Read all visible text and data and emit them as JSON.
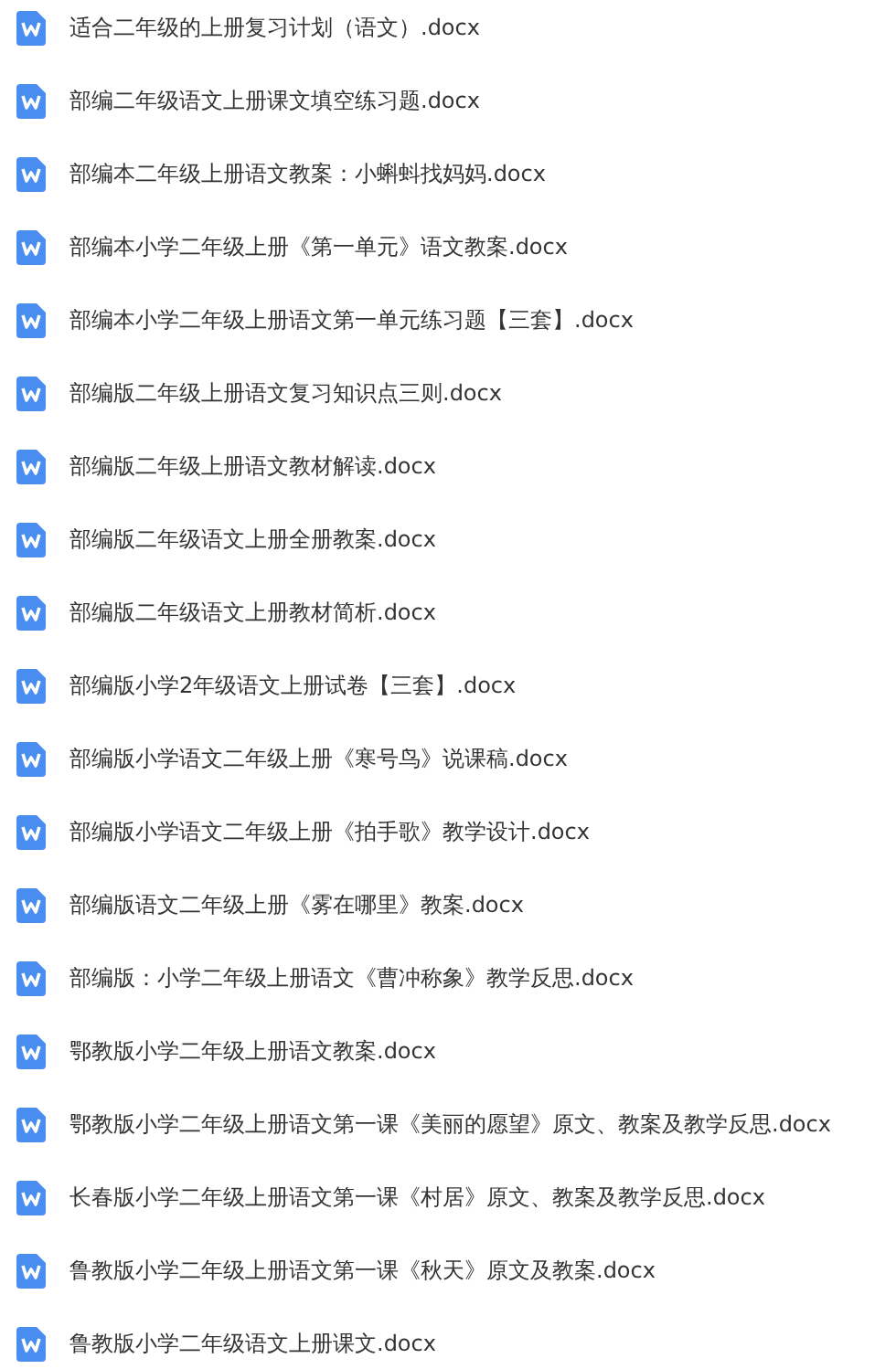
{
  "files": [
    {
      "name": "适合二年级的上册复习计划（语文）.docx"
    },
    {
      "name": "部编二年级语文上册课文填空练习题.docx"
    },
    {
      "name": "部编本二年级上册语文教案：小蝌蚪找妈妈.docx"
    },
    {
      "name": "部编本小学二年级上册《第一单元》语文教案.docx"
    },
    {
      "name": "部编本小学二年级上册语文第一单元练习题【三套】.docx"
    },
    {
      "name": "部编版二年级上册语文复习知识点三则.docx"
    },
    {
      "name": "部编版二年级上册语文教材解读.docx"
    },
    {
      "name": "部编版二年级语文上册全册教案.docx"
    },
    {
      "name": "部编版二年级语文上册教材简析.docx"
    },
    {
      "name": "部编版小学2年级语文上册试卷【三套】.docx"
    },
    {
      "name": "部编版小学语文二年级上册《寒号鸟》说课稿.docx"
    },
    {
      "name": "部编版小学语文二年级上册《拍手歌》教学设计.docx"
    },
    {
      "name": "部编版语文二年级上册《雾在哪里》教案.docx"
    },
    {
      "name": "部编版：小学二年级上册语文《曹冲称象》教学反思.docx"
    },
    {
      "name": "鄂教版小学二年级上册语文教案.docx"
    },
    {
      "name": "鄂教版小学二年级上册语文第一课《美丽的愿望》原文、教案及教学反思.docx"
    },
    {
      "name": "长春版小学二年级上册语文第一课《村居》原文、教案及教学反思.docx"
    },
    {
      "name": "鲁教版小学二年级上册语文第一课《秋天》原文及教案.docx"
    },
    {
      "name": "鲁教版小学二年级语文上册课文.docx"
    }
  ]
}
